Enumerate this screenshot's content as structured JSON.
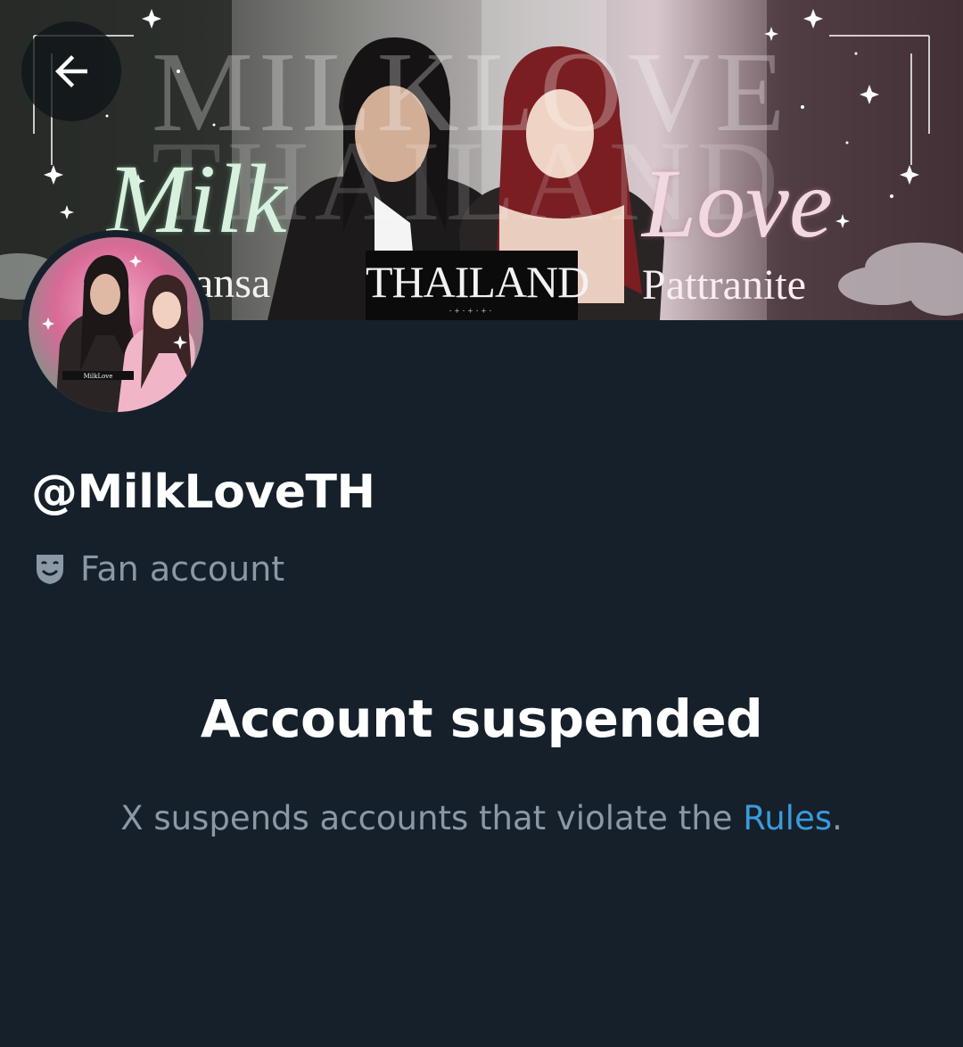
{
  "header": {
    "back_button_label": "Back",
    "banner": {
      "background_text_top": "MILKLOVE",
      "background_text_bottom": "THAILAND",
      "script_left": "Milk",
      "script_right": "Love",
      "name_left": "ansa",
      "name_right": "Pattranite",
      "center_box": "THAILAND",
      "center_box_ornament": "·+·+·+·"
    }
  },
  "avatar": {
    "alt": "MilkLoveTH profile picture",
    "caption": "MilkLove"
  },
  "profile": {
    "handle": "@MilkLoveTH",
    "label_icon": "theater-masks-icon",
    "label": "Fan account"
  },
  "suspension": {
    "title": "Account suspended",
    "description_prefix": "X suspends accounts that violate the ",
    "rules_link": "Rules",
    "description_suffix": "."
  },
  "colors": {
    "background": "#16202b",
    "primary_text": "#ffffff",
    "secondary_text": "#8b98a5",
    "link": "#3a9bdc"
  }
}
